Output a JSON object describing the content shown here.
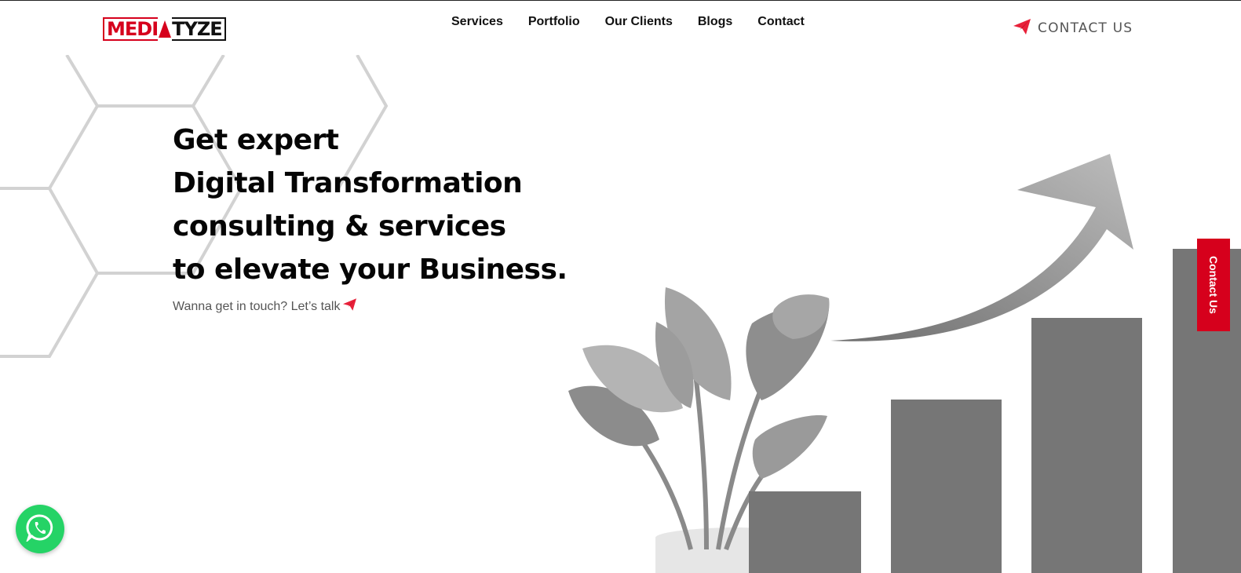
{
  "brand": {
    "logo_text_left": "MEDI",
    "logo_text_right": "TYZE",
    "accent_color": "#d6001c"
  },
  "nav": {
    "items": [
      {
        "label": "Services"
      },
      {
        "label": "Portfolio"
      },
      {
        "label": "Our Clients"
      },
      {
        "label": "Blogs"
      },
      {
        "label": "Contact"
      }
    ]
  },
  "header_cta": {
    "label": "CONTACT US",
    "icon": "paper-plane-icon"
  },
  "hero": {
    "lines": [
      "Get expert",
      "Digital Transformation",
      "consulting & services",
      "to elevate your Business."
    ],
    "subtext": "Wanna get in touch? Let’s talk",
    "subtext_icon": "paper-plane-icon"
  },
  "side_tab": {
    "label": "Contact Us",
    "color": "#d6001c"
  },
  "whatsapp": {
    "icon": "whatsapp-icon",
    "color": "#25d366"
  }
}
